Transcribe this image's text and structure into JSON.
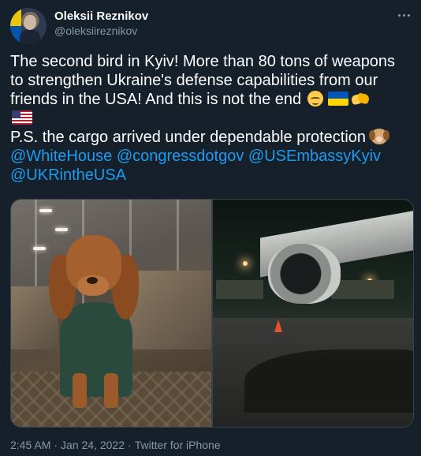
{
  "author": {
    "name": "Oleksii Reznikov",
    "handle": "@oleksiireznikov"
  },
  "tweet": {
    "lines": [
      "The second bird in Kyiv! More than 80 tons of weapons",
      "to strengthen Ukraine's defense capabilities from our",
      "friends in the USA! And this is not the end"
    ],
    "ps": "P.S. the cargo arrived under dependable protection",
    "mentions": [
      "@WhiteHouse",
      "@congressdotgov",
      "@USEmbassyKyiv",
      "@UKRintheUSA"
    ],
    "emojis": [
      "relieved-face",
      "ukraine-flag",
      "handshake",
      "us-flag",
      "dog-face"
    ]
  },
  "media": {
    "photos": [
      "cargo-bay-dog-photo",
      "airplane-engine-night-photo"
    ]
  },
  "meta": {
    "time": "2:45 AM",
    "date": "Jan 24, 2022",
    "source": "Twitter for iPhone",
    "separator": "·"
  },
  "colors": {
    "background": "#15202b",
    "text": "#ffffff",
    "secondary": "#8899a6",
    "link": "#1d9bf0",
    "border": "#38444d"
  }
}
